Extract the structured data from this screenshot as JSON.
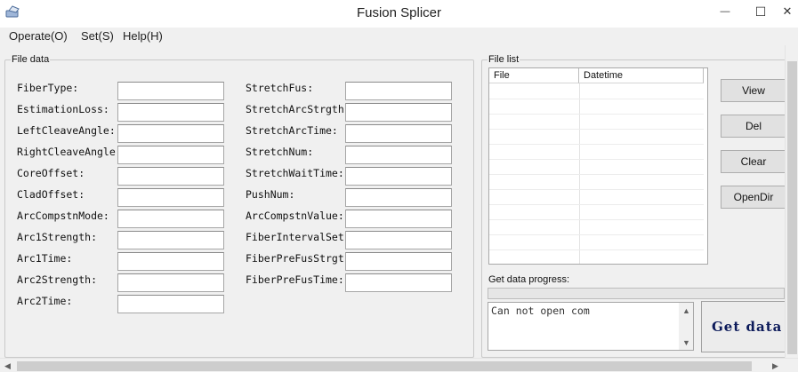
{
  "window": {
    "title": "Fusion Splicer",
    "minimize_glyph": "—",
    "maximize_glyph": "☐",
    "close_glyph": "✕"
  },
  "menu": [
    {
      "label": "Operate(O)"
    },
    {
      "label": "Set(S)"
    },
    {
      "label": "Help(H)"
    }
  ],
  "file_data": {
    "group_label": "File data",
    "left_fields": [
      {
        "label": "FiberType:",
        "value": ""
      },
      {
        "label": "EstimationLoss:",
        "value": ""
      },
      {
        "label": "LeftCleaveAngle:",
        "value": ""
      },
      {
        "label": "RightCleaveAngle",
        "value": ""
      },
      {
        "label": "CoreOffset:",
        "value": ""
      },
      {
        "label": "CladOffset:",
        "value": ""
      },
      {
        "label": "ArcCompstnMode:",
        "value": ""
      },
      {
        "label": "Arc1Strength:",
        "value": ""
      },
      {
        "label": "Arc1Time:",
        "value": ""
      },
      {
        "label": "Arc2Strength:",
        "value": ""
      },
      {
        "label": "Arc2Time:",
        "value": ""
      }
    ],
    "right_fields": [
      {
        "label": "StretchFus:",
        "value": ""
      },
      {
        "label": "StretchArcStrgth",
        "value": ""
      },
      {
        "label": "StretchArcTime:",
        "value": ""
      },
      {
        "label": "StretchNum:",
        "value": ""
      },
      {
        "label": "StretchWaitTime:",
        "value": ""
      },
      {
        "label": "PushNum:",
        "value": ""
      },
      {
        "label": "ArcCompstnValue:",
        "value": ""
      },
      {
        "label": "FiberIntervalSet",
        "value": ""
      },
      {
        "label": "FiberPreFusStrgt",
        "value": ""
      },
      {
        "label": "FiberPreFusTime:",
        "value": ""
      }
    ]
  },
  "file_list": {
    "group_label": "File list",
    "columns": [
      "File",
      "Datetime"
    ],
    "rows": [],
    "buttons": {
      "view": "View",
      "del": "Del",
      "clear": "Clear",
      "opendir": "OpenDir"
    },
    "progress_label": "Get data progress:",
    "progress_value": 0,
    "status_text": "Can not open com",
    "get_data_label": "Get data"
  },
  "scroll_glyphs": {
    "up": "▲",
    "down": "▼",
    "left": "◀",
    "right": "▶"
  }
}
